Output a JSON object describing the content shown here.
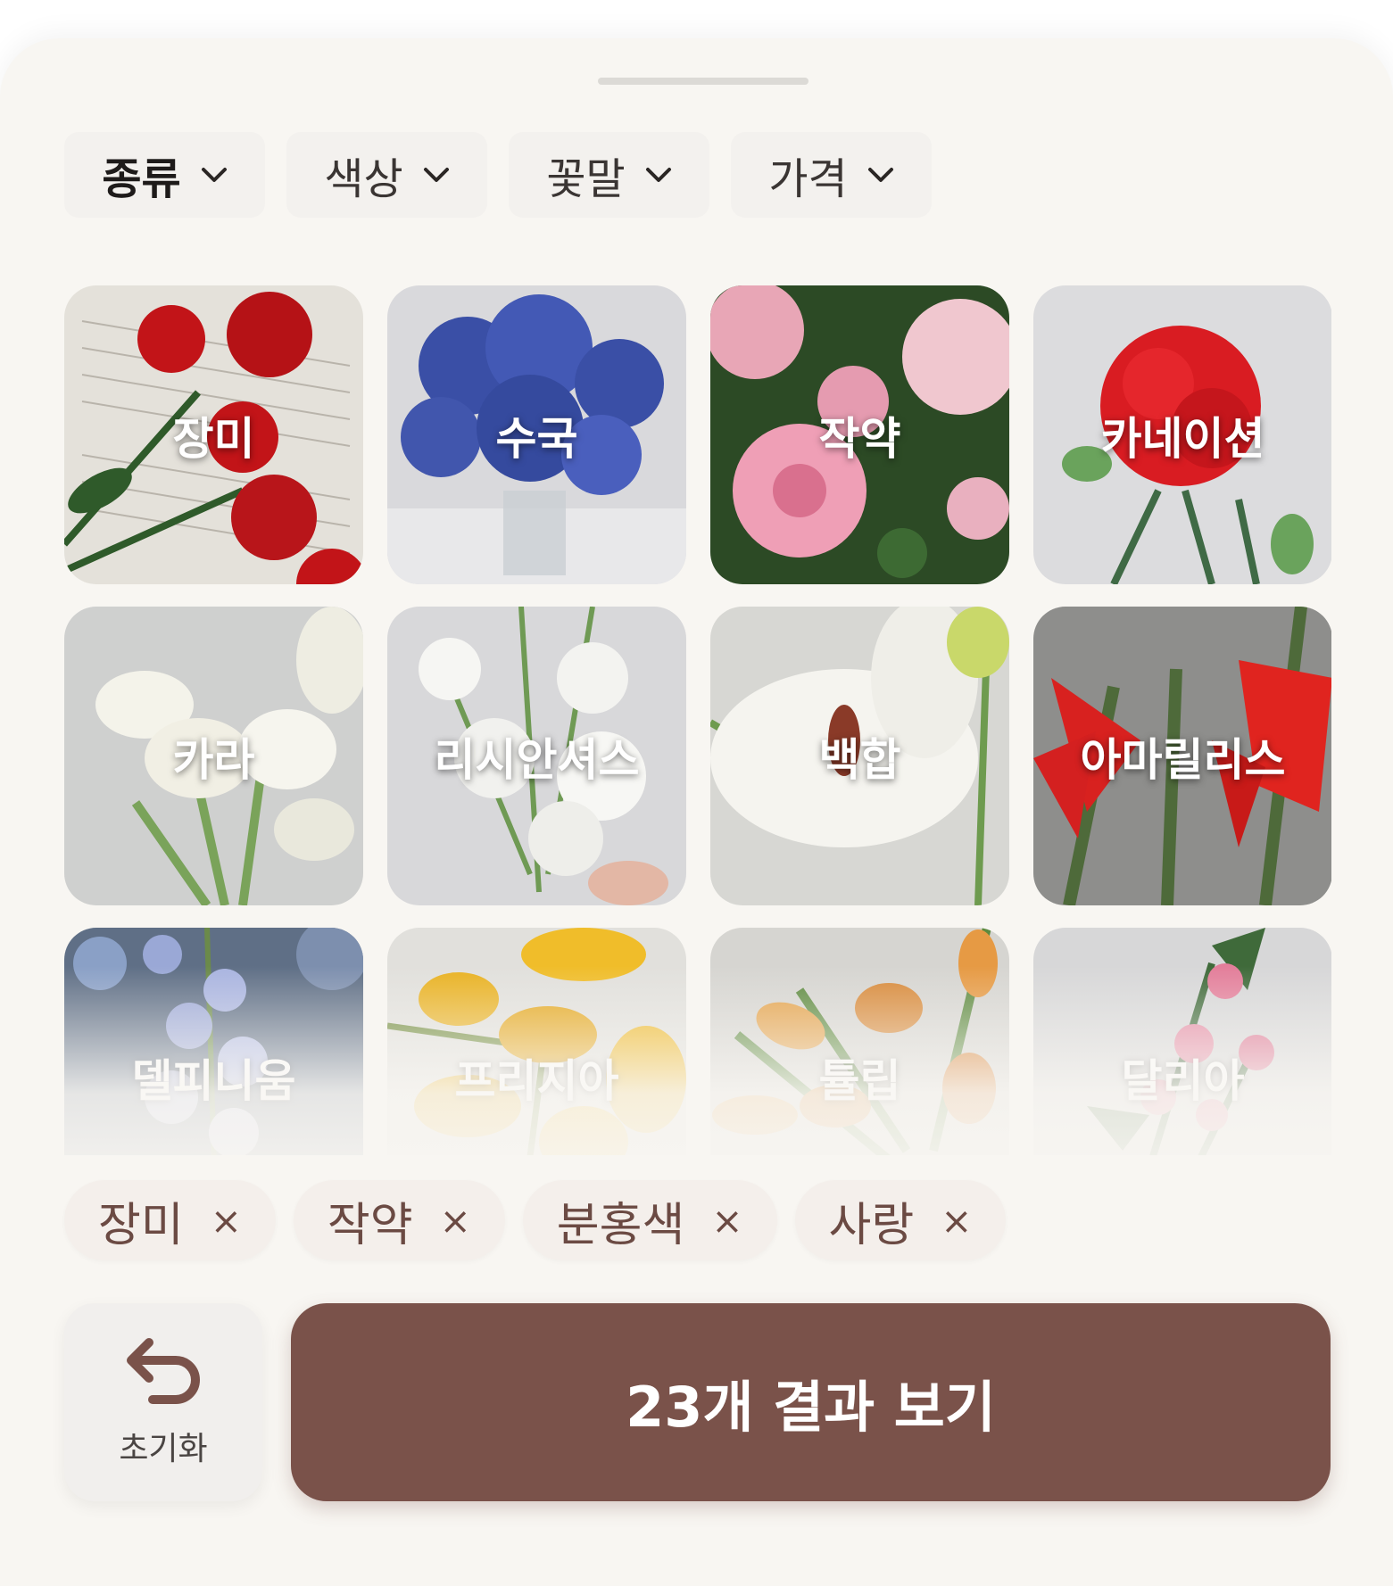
{
  "filters": [
    {
      "label": "종류",
      "active": true
    },
    {
      "label": "색상",
      "active": false
    },
    {
      "label": "꽃말",
      "active": false
    },
    {
      "label": "가격",
      "active": false
    }
  ],
  "flowers": [
    {
      "name": "장미"
    },
    {
      "name": "수국"
    },
    {
      "name": "작약"
    },
    {
      "name": "카네이션"
    },
    {
      "name": "카라"
    },
    {
      "name": "리시안셔스"
    },
    {
      "name": "백합"
    },
    {
      "name": "아마릴리스"
    },
    {
      "name": "델피니움"
    },
    {
      "name": "프리지아"
    },
    {
      "name": "튤립"
    },
    {
      "name": "달리아"
    }
  ],
  "selected_chips": [
    {
      "label": "장미",
      "remove": "×"
    },
    {
      "label": "작약",
      "remove": "×"
    },
    {
      "label": "분홍색",
      "remove": "×"
    },
    {
      "label": "사랑",
      "remove": "×"
    }
  ],
  "actions": {
    "reset_label": "초기화",
    "result_label": "23개 결과 보기"
  },
  "colors": {
    "accent": "#7a524a",
    "chip_text": "#6b4a43",
    "background": "#f8f6f2"
  }
}
